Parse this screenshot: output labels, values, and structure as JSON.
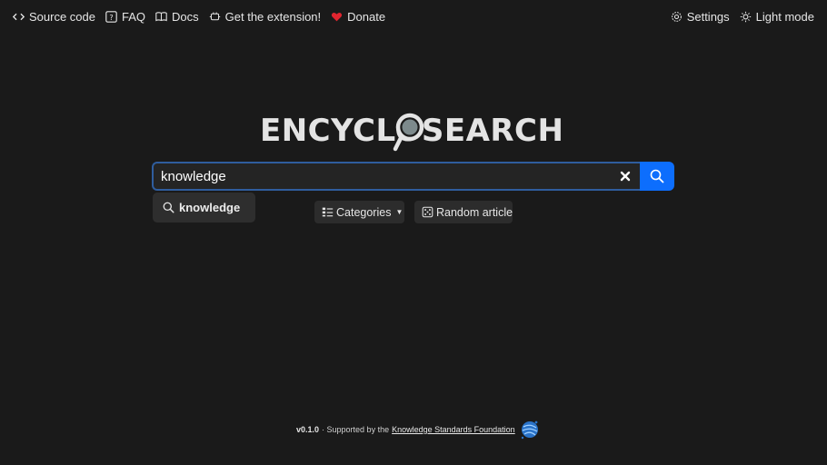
{
  "nav": {
    "left": [
      {
        "label": "Source code",
        "icon": "code-icon"
      },
      {
        "label": "FAQ",
        "icon": "question-square-icon"
      },
      {
        "label": "Docs",
        "icon": "book-icon"
      },
      {
        "label": "Get the extension!",
        "icon": "plugin-icon"
      },
      {
        "label": "Donate",
        "icon": "heart-icon"
      }
    ],
    "right": [
      {
        "label": "Settings",
        "icon": "gear-icon"
      },
      {
        "label": "Light mode",
        "icon": "sun-icon"
      }
    ]
  },
  "logo": {
    "text": "ENCYCLOSEARCH"
  },
  "search": {
    "value": "knowledge",
    "clear_icon": "close-icon",
    "submit_icon": "search-icon"
  },
  "suggestions": [
    {
      "label": "knowledge",
      "icon": "search-icon"
    }
  ],
  "actions": {
    "categories_label": "Categories",
    "random_label": "Random article"
  },
  "footer": {
    "version": "v0.1.0",
    "supported_text": "· Supported by the",
    "org_link": "Knowledge Standards Foundation"
  },
  "colors": {
    "background": "#1a1a1a",
    "accent": "#0d6efd",
    "heart": "#e0252f",
    "input_border": "#2f5d9e"
  }
}
